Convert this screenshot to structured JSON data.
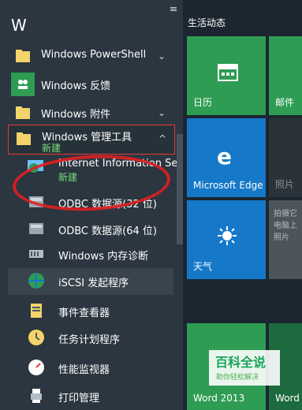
{
  "left": {
    "letter": "W",
    "items": [
      {
        "label": "Windows PowerShell",
        "chevron": "down",
        "icon": "folder-icon"
      },
      {
        "label": "Windows 反馈",
        "icon": "people-icon"
      },
      {
        "label": "Windows 附件",
        "chevron": "down",
        "icon": "folder-icon"
      },
      {
        "label": "Windows 管理工具",
        "chevron": "up",
        "new": "新建",
        "icon": "folder-icon"
      },
      {
        "label": "Internet Information Se...",
        "new": "新建",
        "icon": "iis-icon"
      },
      {
        "label": "ODBC 数据源(32 位)",
        "icon": "database-icon"
      },
      {
        "label": "ODBC 数据源(64 位)",
        "icon": "database-icon"
      },
      {
        "label": "Windows 内存诊断",
        "icon": "memory-icon"
      },
      {
        "label": "iSCSI 发起程序",
        "icon": "globe-icon"
      },
      {
        "label": "事件查看器",
        "icon": "event-icon"
      },
      {
        "label": "任务计划程序",
        "icon": "clock-icon"
      },
      {
        "label": "性能监视器",
        "icon": "gauge-icon"
      },
      {
        "label": "打印管理",
        "icon": "printer-icon"
      }
    ]
  },
  "right": {
    "group_title": "生活动态",
    "tiles": {
      "calendar": "日历",
      "mail": "邮件",
      "edge": "Microsoft Edge",
      "photos": "照片",
      "photos_hint": "拍摄它\n电脑上\n照片",
      "weather": "天气",
      "word": "Word 2013",
      "word2": "Word 2013"
    }
  },
  "watermark": {
    "title": "百科全说",
    "subtitle": "助你轻松解决"
  },
  "colors": {
    "accent": "#2e9c53",
    "blue": "#1678c8",
    "folder": "#f4d46a",
    "new": "#77dd77",
    "highlight": "#e53935"
  }
}
